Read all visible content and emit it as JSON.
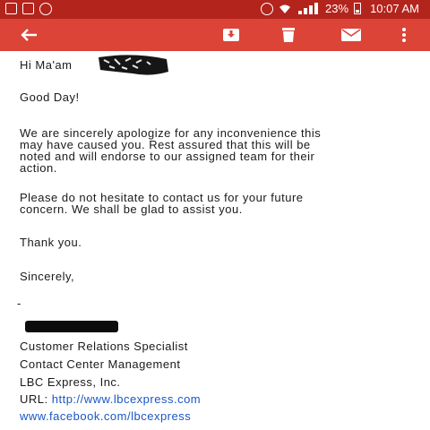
{
  "status_bar": {
    "battery": "23%",
    "time": "10:07 AM"
  },
  "toolbar": {
    "back_icon": "arrow-left-icon",
    "move_icon": "move-to-inbox-icon",
    "delete_icon": "trash-icon",
    "mail_icon": "envelope-icon",
    "more_icon": "more-vert-icon",
    "color": "#db4437",
    "status_color": "#b3241d"
  },
  "email": {
    "greeting": "Hi Ma'am",
    "salutation": "Good Day!",
    "para1": [
      "We are sincerely apologize for any inconvenience this",
      "may have caused you. Rest assured that this will be",
      "noted and will endorse to our assigned team for their",
      "action."
    ],
    "para2": [
      "Please do not hesitate to contact us for your future",
      "concern. We shall be glad to assist you."
    ],
    "thanks": "Thank you.",
    "closing": "Sincerely,",
    "dash": "-",
    "signature": {
      "title": "Customer Relations Specialist",
      "department": "Contact Center Management",
      "company": "LBC Express, Inc.",
      "url_label": "URL:",
      "url": "http://www.lbcexpress.com",
      "facebook": "www.facebook.com/lbcexpress"
    },
    "link_color": "#1a56c4"
  }
}
